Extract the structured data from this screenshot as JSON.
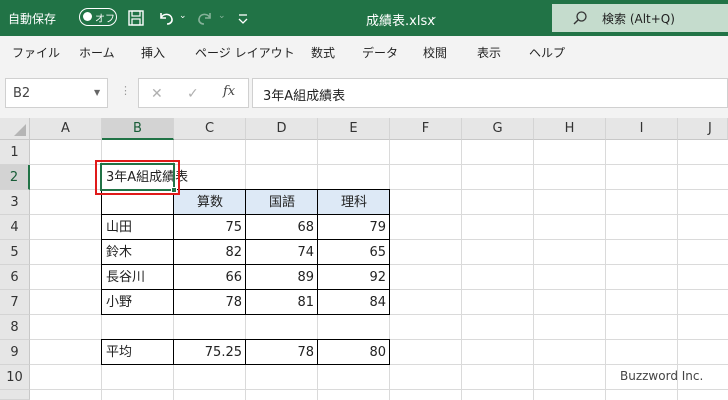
{
  "titlebar": {
    "autosave_label": "自動保存",
    "autosave_state": "オフ",
    "doc_title": "成績表.xlsx",
    "search_text": "検索 (Alt+Q)"
  },
  "ribbon": {
    "tabs": [
      "ファイル",
      "ホーム",
      "挿入",
      "ページ レイアウト",
      "数式",
      "データ",
      "校閲",
      "表示",
      "ヘルプ"
    ]
  },
  "formula_bar": {
    "name_box": "B2",
    "formula": "3年A組成績表"
  },
  "columns": [
    "A",
    "B",
    "C",
    "D",
    "E",
    "F",
    "G",
    "H",
    "I",
    "J"
  ],
  "rows": [
    "1",
    "2",
    "3",
    "4",
    "5",
    "6",
    "7",
    "8",
    "9",
    "10"
  ],
  "sheet": {
    "title": "3年A組成績表",
    "headers": [
      "算数",
      "国語",
      "理科"
    ],
    "students": [
      {
        "name": "山田",
        "scores": [
          "75",
          "68",
          "79"
        ]
      },
      {
        "name": "鈴木",
        "scores": [
          "82",
          "74",
          "65"
        ]
      },
      {
        "name": "長谷川",
        "scores": [
          "66",
          "89",
          "92"
        ]
      },
      {
        "name": "小野",
        "scores": [
          "78",
          "81",
          "84"
        ]
      }
    ],
    "average_label": "平均",
    "averages": [
      "75.25",
      "78",
      "80"
    ]
  },
  "watermark": "Buzzword Inc.",
  "colors": {
    "brand": "#217346",
    "header_fill": "#dde9f6",
    "highlight": "#e01a1a"
  }
}
